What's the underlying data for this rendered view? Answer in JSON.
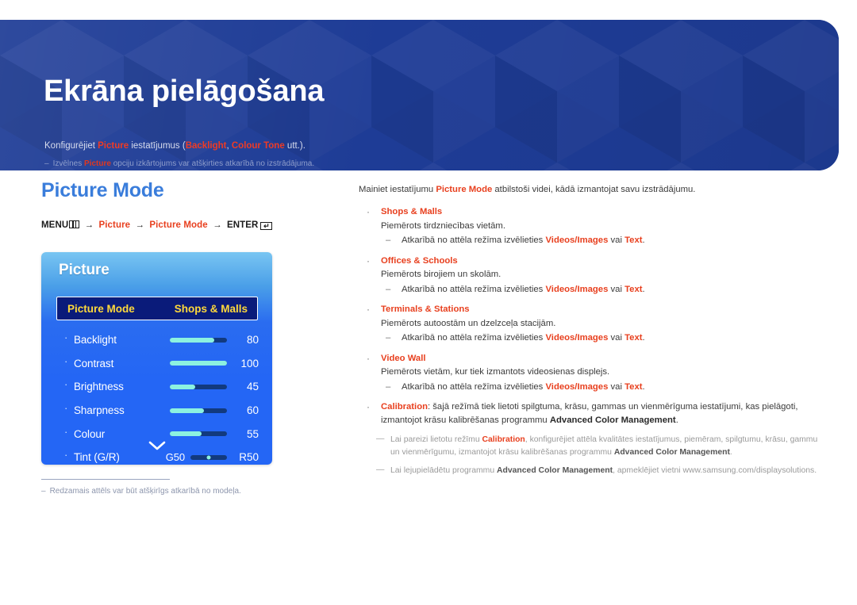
{
  "banner": {
    "title": "Ekrāna pielāgošana",
    "subtitle_pre": "Konfigurējiet ",
    "subtitle_kw1": "Picture",
    "subtitle_mid": " iestatījumus (",
    "subtitle_kw2": "Backlight",
    "subtitle_comma": ", ",
    "subtitle_kw3": "Colour Tone",
    "subtitle_post": " utt.).",
    "note_dash": "‒",
    "note_pre": "Izvēlnes ",
    "note_kw": "Picture",
    "note_post": " opciju izkārtojums var atšķirties atkarībā no izstrādājuma."
  },
  "section": {
    "title": "Picture Mode",
    "menu_path": {
      "menu_label": "MENU",
      "menu_icon": "menu-grid-icon",
      "arrow": "→",
      "step1": "Picture",
      "step2": "Picture Mode",
      "enter_label": "ENTER",
      "enter_icon": "↵"
    }
  },
  "osd": {
    "title": "Picture",
    "selected": {
      "label": "Picture Mode",
      "value": "Shops & Malls"
    },
    "rows": [
      {
        "bullet": "·",
        "name": "Backlight",
        "value": "80",
        "fill_pct": 78
      },
      {
        "bullet": "·",
        "name": "Contrast",
        "value": "100",
        "fill_pct": 100
      },
      {
        "bullet": "·",
        "name": "Brightness",
        "value": "45",
        "fill_pct": 45
      },
      {
        "bullet": "·",
        "name": "Sharpness",
        "value": "60",
        "fill_pct": 60
      },
      {
        "bullet": "·",
        "name": "Colour",
        "value": "55",
        "fill_pct": 55
      }
    ],
    "tint_row": {
      "bullet": "·",
      "name": "Tint (G/R)",
      "left_tag": "G50",
      "right_tag": "R50",
      "knob_pct": 50
    },
    "scroll_hint_icon": "chevron-down-icon"
  },
  "left_footnote": {
    "dash": "‒",
    "text": "Redzamais attēls var būt atšķirīgs atkarībā no modeļa."
  },
  "right": {
    "intro_pre": "Mainiet iestatījumu ",
    "intro_kw": "Picture Mode",
    "intro_post": " atbilstoši videi, kādā izmantojat savu izstrādājumu.",
    "bullets": [
      {
        "dot": "·",
        "head": "Shops & Malls",
        "desc": "Piemērots tirdzniecības vietām.",
        "sub_dash": "‒",
        "sub_pre": "Atkarībā no attēla režīma izvēlieties ",
        "sub_kw1": "Videos/Images",
        "sub_mid": " vai ",
        "sub_kw2": "Text",
        "sub_post": "."
      },
      {
        "dot": "·",
        "head": "Offices & Schools",
        "desc": "Piemērots birojiem un skolām.",
        "sub_dash": "‒",
        "sub_pre": "Atkarībā no attēla režīma izvēlieties ",
        "sub_kw1": "Videos/Images",
        "sub_mid": " vai ",
        "sub_kw2": "Text",
        "sub_post": "."
      },
      {
        "dot": "·",
        "head": "Terminals & Stations",
        "desc": "Piemērots autoostām un dzelzceļa stacijām.",
        "sub_dash": "‒",
        "sub_pre": "Atkarībā no attēla režīma izvēlieties ",
        "sub_kw1": "Videos/Images",
        "sub_mid": " vai ",
        "sub_kw2": "Text",
        "sub_post": "."
      },
      {
        "dot": "·",
        "head": "Video Wall",
        "desc": "Piemērots vietām, kur tiek izmantots videosienas displejs.",
        "sub_dash": "‒",
        "sub_pre": "Atkarībā no attēla režīma izvēlieties ",
        "sub_kw1": "Videos/Images",
        "sub_mid": " vai ",
        "sub_kw2": "Text",
        "sub_post": "."
      }
    ],
    "calibration": {
      "dot": "·",
      "head": "Calibration",
      "body_pre": ": šajā režīmā tiek lietoti spilgtuma, krāsu, gammas un vienmērīguma iestatījumi, kas pielāgoti, izmantojot krāsu kalibrēšanas programmu ",
      "body_bold": "Advanced Color Management",
      "body_post": "."
    },
    "notes": [
      {
        "dash": "—",
        "pre": "Lai pareizi lietotu režīmu ",
        "kw": "Calibration",
        "mid": ", konfigurējiet attēla kvalitātes iestatījumus, piemēram, spilgtumu, krāsu, gammu un vienmērīgumu, izmantojot krāsu kalibrēšanas programmu ",
        "bold": "Advanced Color Management",
        "post": "."
      },
      {
        "dash": "—",
        "pre": "Lai lejupielādētu programmu ",
        "kw": "",
        "mid": "",
        "bold": "Advanced Color Management",
        "post": ", apmeklējiet vietni www.samsung.com/displaysolutions."
      }
    ]
  },
  "colors": {
    "banner_blue": "#1e3c96",
    "accent_orange": "#e8401f",
    "section_blue": "#3a7ddb",
    "osd_blue": "#2466f5",
    "osd_highlight": "#0a1b7a",
    "osd_yellow": "#ffd93b",
    "slider_fill": "#8cf2e0"
  }
}
